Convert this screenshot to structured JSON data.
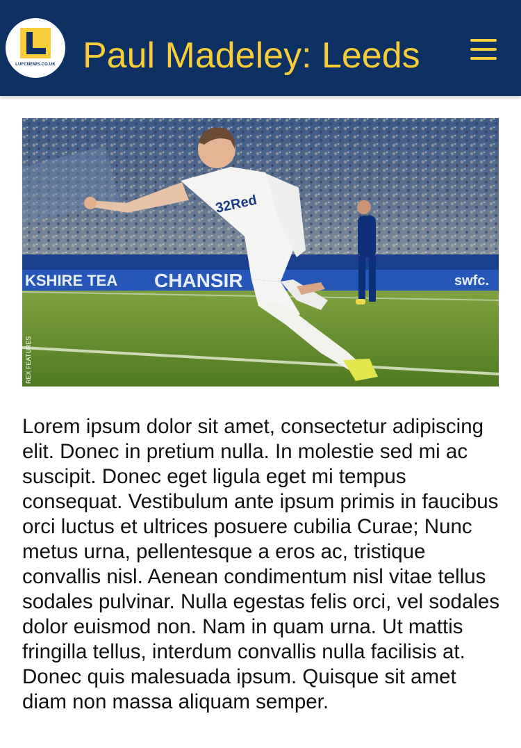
{
  "header": {
    "logo_text": "LUFCNEWS.CO.UK",
    "title": "Paul Madeley: Leeds",
    "menu_icon": "hamburger-menu-icon"
  },
  "photo": {
    "credit": "REX FEATURES",
    "banner_texts": [
      "KSHIRE TEA",
      "CHANSIR",
      "swfc."
    ],
    "shirt_sponsor": "32Red"
  },
  "article": {
    "body": "Lorem ipsum dolor sit amet, consectetur adipiscing elit. Donec in pretium nulla. In molestie sed mi ac suscipit. Donec eget ligula eget mi tempus consequat. Vestibulum ante ipsum primis in faucibus orci luctus et ultrices posuere cubilia Curae; Nunc metus urna, pellentesque a eros ac, tristique convallis nisl. Aenean condimentum nisl vitae tellus sodales pulvinar. Nulla egestas felis orci, vel sodales dolor euismod non. Nam in quam urna. Ut mattis fringilla tellus, interdum convallis nulla facilisis at. Donec quis malesuada ipsum. Quisque sit amet diam non massa aliquam semper."
  },
  "colors": {
    "header_bg": "#0d3162",
    "accent_yellow": "#f7cd3a",
    "text": "#111111"
  }
}
